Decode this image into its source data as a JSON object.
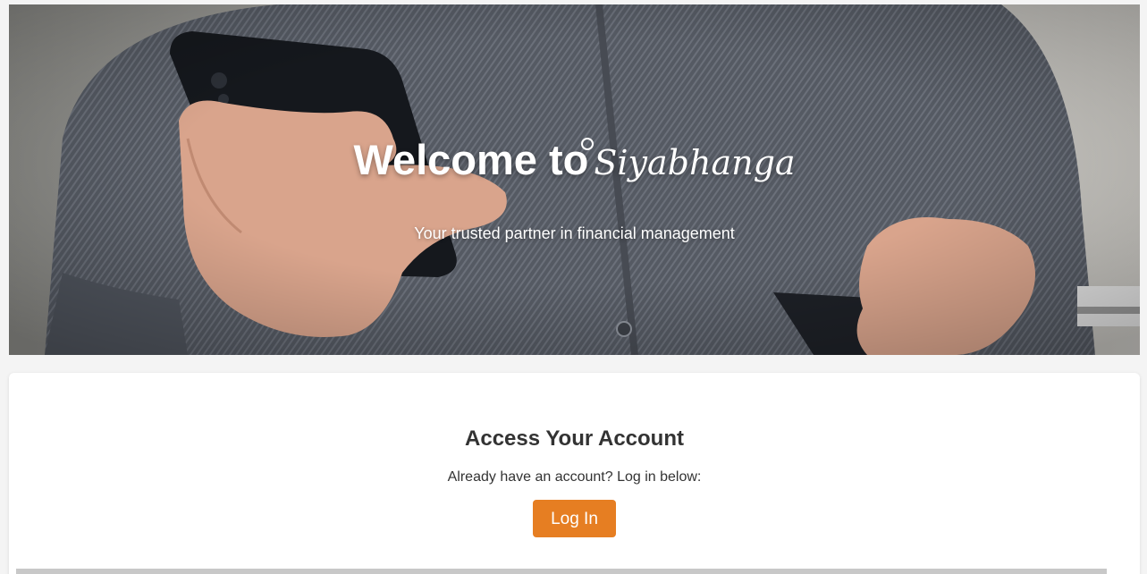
{
  "hero": {
    "title_prefix": "Welcome to",
    "brand": "Siyabhanga",
    "subtitle": "Your trusted partner in financial management"
  },
  "account": {
    "heading": "Access Your Account",
    "prompt": "Already have an account? Log in below:",
    "login_label": "Log In"
  },
  "colors": {
    "accent": "#e67e22",
    "text": "#333333",
    "background": "#f4f4f4"
  }
}
